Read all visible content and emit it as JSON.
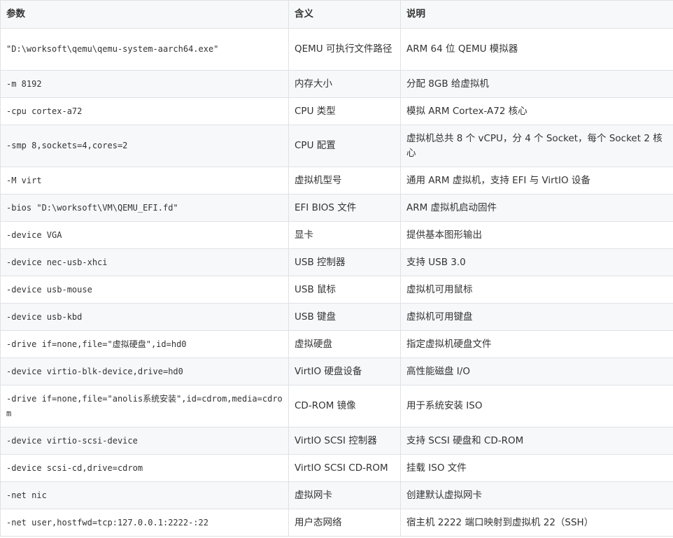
{
  "headers": {
    "param": "参数",
    "meaning": "含义",
    "description": "说明"
  },
  "rows": [
    {
      "param": "\"D:\\worksoft\\qemu\\qemu-system-aarch64.exe\"",
      "meaning": "QEMU 可执行文件路径",
      "description": "ARM 64 位 QEMU 模拟器"
    },
    {
      "param": "-m 8192",
      "meaning": "内存大小",
      "description": "分配 8GB 给虚拟机"
    },
    {
      "param": "-cpu cortex-a72",
      "meaning": "CPU 类型",
      "description": "模拟 ARM Cortex-A72 核心"
    },
    {
      "param": "-smp 8,sockets=4,cores=2",
      "meaning": "CPU 配置",
      "description": "虚拟机总共 8 个 vCPU，分 4 个 Socket，每个 Socket 2 核心"
    },
    {
      "param": "-M virt",
      "meaning": "虚拟机型号",
      "description": "通用 ARM 虚拟机，支持 EFI 与 VirtIO 设备"
    },
    {
      "param": "-bios \"D:\\worksoft\\VM\\QEMU_EFI.fd\"",
      "meaning": "EFI BIOS 文件",
      "description": "ARM 虚拟机启动固件"
    },
    {
      "param": "-device VGA",
      "meaning": "显卡",
      "description": "提供基本图形输出"
    },
    {
      "param": "-device nec-usb-xhci",
      "meaning": "USB 控制器",
      "description": "支持 USB 3.0"
    },
    {
      "param": "-device usb-mouse",
      "meaning": "USB 鼠标",
      "description": "虚拟机可用鼠标"
    },
    {
      "param": "-device usb-kbd",
      "meaning": "USB 键盘",
      "description": "虚拟机可用键盘"
    },
    {
      "param": "-drive if=none,file=\"虚拟硬盘\",id=hd0",
      "meaning": "虚拟硬盘",
      "description": "指定虚拟机硬盘文件"
    },
    {
      "param": "-device virtio-blk-device,drive=hd0",
      "meaning": "VirtIO 硬盘设备",
      "description": "高性能磁盘 I/O"
    },
    {
      "param": "-drive if=none,file=\"anolis系统安装\",id=cdrom,media=cdrom",
      "meaning": "CD-ROM 镜像",
      "description": "用于系统安装 ISO"
    },
    {
      "param": "-device virtio-scsi-device",
      "meaning": "VirtIO SCSI 控制器",
      "description": "支持 SCSI 硬盘和 CD-ROM"
    },
    {
      "param": "-device scsi-cd,drive=cdrom",
      "meaning": "VirtIO SCSI CD-ROM",
      "description": "挂载 ISO 文件"
    },
    {
      "param": "-net nic",
      "meaning": "虚拟网卡",
      "description": "创建默认虚拟网卡"
    },
    {
      "param": "-net user,hostfwd=tcp:127.0.0.1:2222-:22",
      "meaning": "用户态网络",
      "description": "宿主机 2222 端口映射到虚拟机 22（SSH）"
    }
  ]
}
